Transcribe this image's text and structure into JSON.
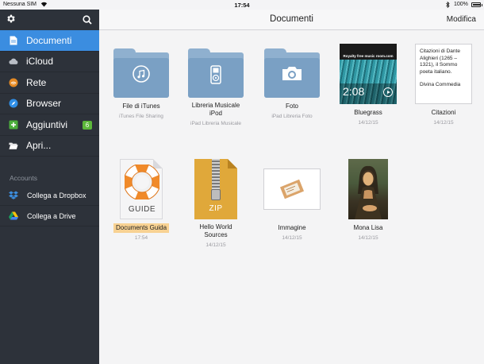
{
  "status_bar": {
    "carrier": "Nessuna SIM",
    "time": "17:54",
    "battery": "100%",
    "battery_level": 1.0
  },
  "sidebar": {
    "items": [
      {
        "label": "Documenti",
        "icon": "document-icon",
        "active": true
      },
      {
        "label": "iCloud",
        "icon": "cloud-icon"
      },
      {
        "label": "Rete",
        "icon": "network-icon"
      },
      {
        "label": "Browser",
        "icon": "compass-icon"
      },
      {
        "label": "Aggiuntivi",
        "icon": "plus-icon",
        "badge": "6"
      },
      {
        "label": "Apri...",
        "icon": "open-folder-icon"
      }
    ],
    "accounts_header": "Accounts",
    "accounts": [
      {
        "label": "Collega a Dropbox",
        "icon": "dropbox-icon"
      },
      {
        "label": "Collega a Drive",
        "icon": "google-drive-icon"
      }
    ]
  },
  "header": {
    "title": "Documenti",
    "edit_label": "Modifica"
  },
  "files": [
    {
      "name": "File di iTunes",
      "sub": "iTunes File Sharing",
      "kind": "folder",
      "glyph": "music-note-icon"
    },
    {
      "name": "Libreria Musicale iPod",
      "sub": "iPad Libreria Musicale",
      "kind": "folder",
      "glyph": "ipod-icon"
    },
    {
      "name": "Foto",
      "sub": "iPad Libreria Foto",
      "kind": "folder",
      "glyph": "camera-icon"
    },
    {
      "name": "Bluegrass",
      "sub": "14/12/15",
      "kind": "video",
      "duration": "2:08",
      "watermark": "Royalty free music room.com"
    },
    {
      "name": "Citazioni",
      "sub": "14/12/15",
      "kind": "text",
      "preview_1": "Citazioni di Dante Alighieri (1265 – 1321), il Sommo poeta italiano.",
      "preview_2": "Divina Commedia"
    },
    {
      "name": "Documents Guida",
      "sub": "17:54",
      "kind": "guide",
      "label": "GUIDE",
      "selected": true
    },
    {
      "name": "Hello World Sources",
      "sub": "14/12/15",
      "kind": "zip",
      "label": "ZIP"
    },
    {
      "name": "Immagine",
      "sub": "14/12/15",
      "kind": "image"
    },
    {
      "name": "Mona Lisa",
      "sub": "14/12/15",
      "kind": "painting"
    }
  ],
  "colors": {
    "sidebar_bg": "#2d323a",
    "active_item": "#3b8de0",
    "badge_green": "#5cb83a",
    "folder_blue": "#7aa0c4",
    "selection": "#f8d293"
  }
}
